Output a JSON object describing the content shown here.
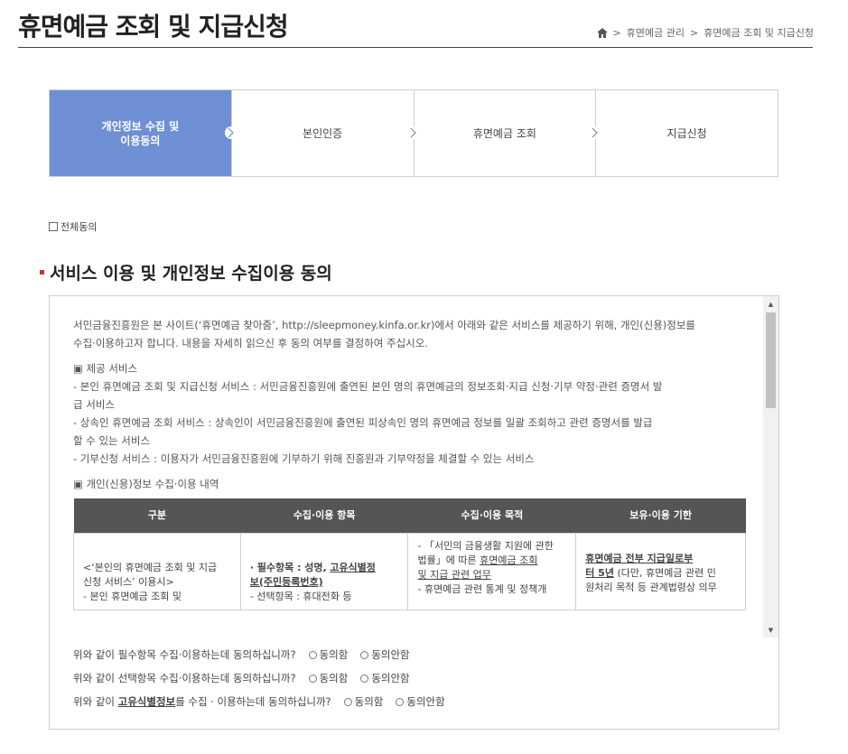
{
  "page_title": "휴면예금 조회 및 지급신청",
  "breadcrumb": {
    "items": [
      "휴면예금 관리",
      "휴면예금 조회 및 지급신청"
    ]
  },
  "steps": [
    {
      "label": "개인정보 수집 및\n이용동의",
      "active": true
    },
    {
      "label": "본인인증",
      "active": false
    },
    {
      "label": "휴면예금 조회",
      "active": false
    },
    {
      "label": "지급신청",
      "active": false
    }
  ],
  "agree_all_label": "전체동의",
  "section_title": "서비스 이용 및 개인정보 수집이용 동의",
  "terms": {
    "intro_1": "서민금융진흥원은 본 사이트(‘휴면예금 찾아줌’, http://sleepmoney.kinfa.or.kr)에서 아래와 같은 서비스를 제공하기 위해, 개인(신용)정보를",
    "intro_2": "수집·이용하고자 합니다. 내용을 자세히 읽으신 후 동의 여부를 결정하여 주십시오.",
    "service_header": "▣ 제공 서비스",
    "service_1a": "- 본인 휴면예금 조회 및 지급신청 서비스 : 서민금융진흥원에 출연된 본인 명의 휴면예금의 정보조회·지급 신청·기부 약정·관련 증명서 발",
    "service_1b": "급 서비스",
    "service_2a": "- 상속인 휴면예금 조회 서비스 : 상속인이 서민금융진흥원에 출연된 피상속인 명의 휴면예금 정보를 일괄 조회하고 관련 증명서를 발급",
    "service_2b": "할 수 있는 서비스",
    "service_3": "- 기부신청 서비스 : 이용자가 서민금융진흥원에 기부하기 위해 진흥원과 기부약정을 체결할 수 있는 서비스",
    "collect_header": "▣ 개인(신용)정보 수집·이용 내역",
    "table": {
      "headers": [
        "구분",
        "수집·이용 항목",
        "수집·이용 목적",
        "보유·이용 기한"
      ],
      "row1": {
        "c1_a": "<‘본인의 휴면예금 조회 및 지급",
        "c1_b": "신청 서비스’ 이용시>",
        "c1_c": "- 본인 휴면예금 조회 및",
        "c2_prefix": "· 필수항목 : 성명,",
        "c2_u1": "고유식별정",
        "c2_u2": "보(주민등록번호)",
        "c2_c": "- 선택항목 : 휴대전화 등",
        "c3_a": "- 「서민의 금융생활 지원에 관한",
        "c3_b_prefix": "법률」에 따른",
        "c3_b_u": "휴면예금 조회",
        "c3_c_u": "및 지급 관련 업무",
        "c3_d": "- 휴면예금 관련 통계 및 정책개",
        "c4_u1": "휴면예금 전부 지급일로부",
        "c4_u2": "터 5년",
        "c4_b": " (다만, 휴면예금 관련 민",
        "c4_c": "원처리 목적 등 관계법령상 의무"
      }
    }
  },
  "questions": [
    {
      "prefix": "위와 같이 필수항목 수집·이용하는데 동의하십니까?",
      "bold": "",
      "suffix": ""
    },
    {
      "prefix": "위와 같이 선택항목 수집·이용하는데 동의하십니까?",
      "bold": "",
      "suffix": ""
    },
    {
      "prefix": "위와 같이 ",
      "bold": "고유식별정보",
      "suffix": "를 수집 · 이용하는데 동의하십니까?"
    }
  ],
  "option_agree": "동의함",
  "option_disagree": "동의안함"
}
